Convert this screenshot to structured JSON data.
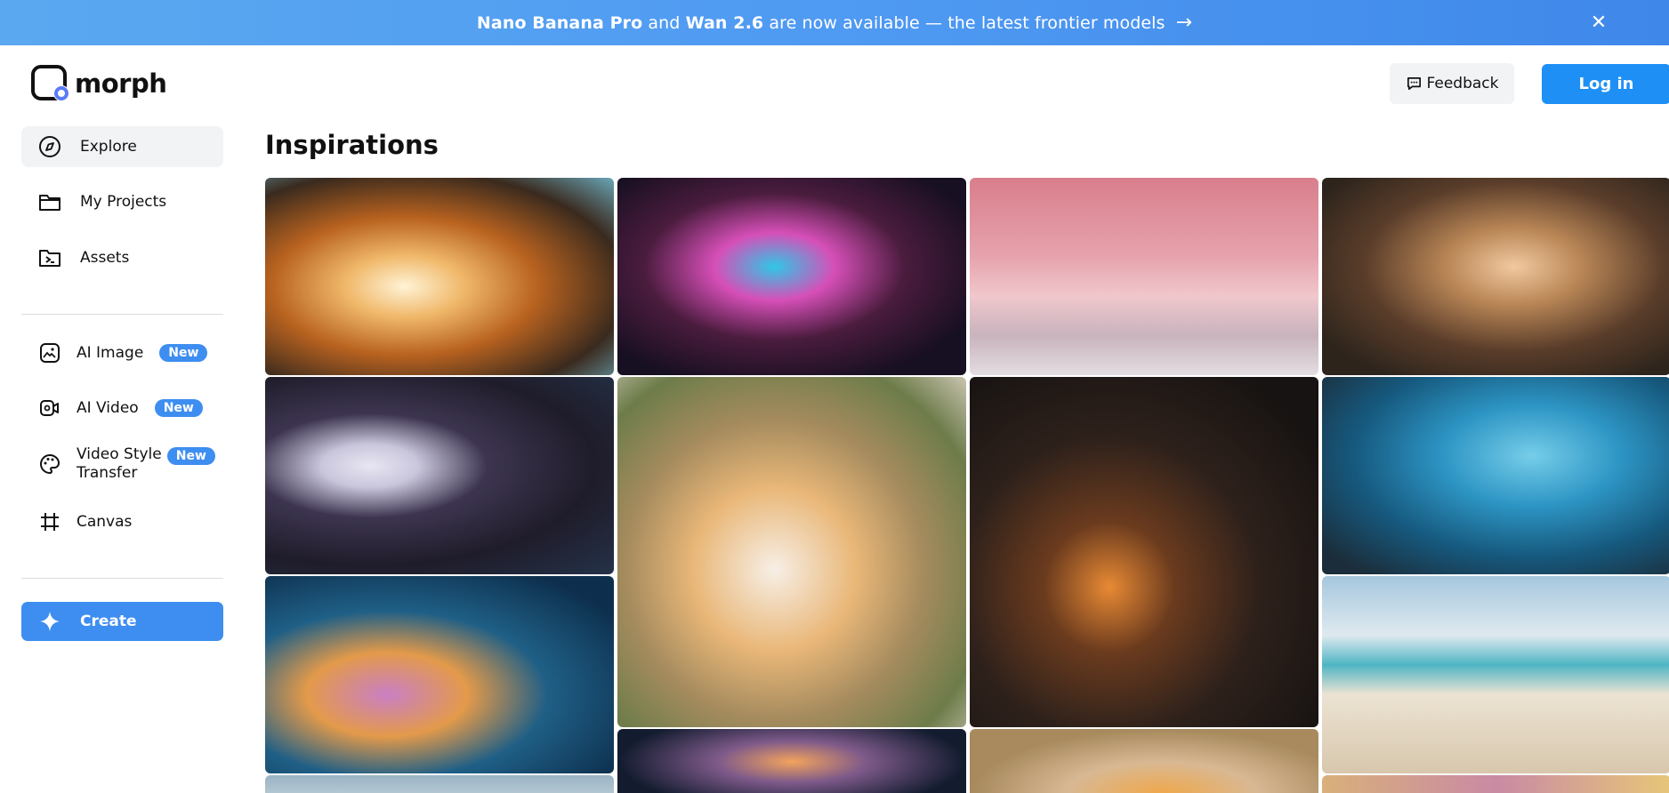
{
  "banner": {
    "model1": "Nano Banana Pro",
    "and": "and",
    "model2": "Wan 2.6",
    "rest": "are now available — the latest frontier models",
    "arrow": "→",
    "close": "✕"
  },
  "header": {
    "logo_text": "morph",
    "feedback_label": "Feedback",
    "login_label": "Log in"
  },
  "sidebar": {
    "nav": [
      {
        "label": "Explore",
        "icon": "compass-icon"
      },
      {
        "label": "My Projects",
        "icon": "folder-icon"
      },
      {
        "label": "Assets",
        "icon": "assets-folder-icon"
      }
    ],
    "tools": [
      {
        "label": "AI Image",
        "badge": "New",
        "icon": "image-icon"
      },
      {
        "label": "AI Video",
        "badge": "New",
        "icon": "video-camera-icon"
      },
      {
        "label": "Video Style",
        "label2": "Transfer",
        "badge": "New",
        "icon": "palette-icon"
      },
      {
        "label": "Canvas",
        "icon": "canvas-crop-icon"
      }
    ],
    "create_label": "Create"
  },
  "main": {
    "title": "Inspirations"
  },
  "colors": {
    "accent": "#3d8ef0",
    "login": "#1e90f5",
    "banner": "#4f9af2"
  }
}
